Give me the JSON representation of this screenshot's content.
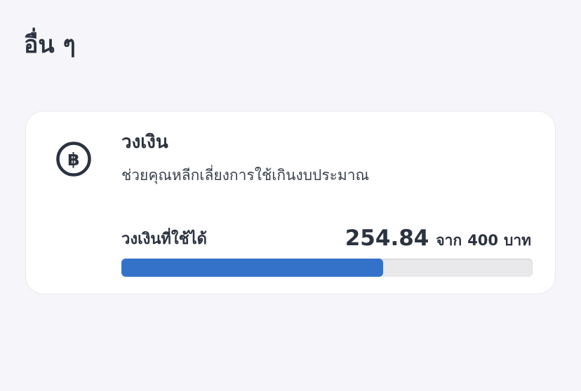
{
  "section": {
    "title": "อื่น ๆ"
  },
  "credit_card": {
    "icon": "baht-icon",
    "title": "วงเงิน",
    "description": "ช่วยคุณหลีกเลี่ยงการใช้เกินงบประมาณ",
    "available_label": "วงเงินที่ใช้ได้",
    "available_amount": "254.84",
    "of_label": "จาก",
    "limit_amount": "400",
    "currency_unit": "บาท",
    "progress_fraction": 0.637,
    "progress_color": "#3372c8"
  }
}
